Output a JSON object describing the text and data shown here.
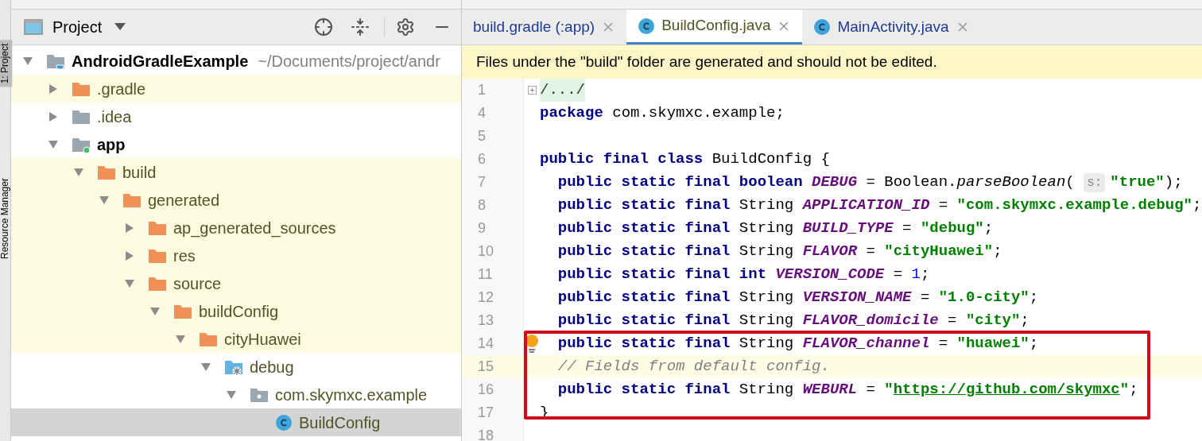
{
  "side_tabs": [
    {
      "label": "1: Project",
      "selected": true
    },
    {
      "label": "Resource Manager",
      "selected": false
    }
  ],
  "project_panel": {
    "title": "Project",
    "tree": [
      {
        "name": "AndroidGradleExample",
        "path": "~/Documents/project/andr",
        "bold": true,
        "kind": "project",
        "expanded": true,
        "excluded": false,
        "selected": false,
        "children": [
          {
            "name": ".gradle",
            "kind": "folder-orange",
            "expanded": false,
            "excluded": true,
            "selected": false
          },
          {
            "name": ".idea",
            "kind": "folder-gray",
            "expanded": false,
            "excluded": false,
            "selected": false
          },
          {
            "name": "app",
            "bold": true,
            "kind": "module",
            "expanded": true,
            "excluded": false,
            "selected": false,
            "children": [
              {
                "name": "build",
                "kind": "folder-orange",
                "expanded": true,
                "excluded": true,
                "selected": false,
                "children": [
                  {
                    "name": "generated",
                    "kind": "folder-orange",
                    "expanded": true,
                    "excluded": true,
                    "selected": false,
                    "children": [
                      {
                        "name": "ap_generated_sources",
                        "kind": "folder-orange",
                        "expanded": false,
                        "excluded": true,
                        "selected": false
                      },
                      {
                        "name": "res",
                        "kind": "folder-orange",
                        "expanded": false,
                        "excluded": true,
                        "selected": false
                      },
                      {
                        "name": "source",
                        "kind": "folder-orange",
                        "expanded": true,
                        "excluded": true,
                        "selected": false,
                        "children": [
                          {
                            "name": "buildConfig",
                            "kind": "folder-orange",
                            "expanded": true,
                            "excluded": true,
                            "selected": false,
                            "children": [
                              {
                                "name": "cityHuawei",
                                "kind": "folder-orange",
                                "expanded": true,
                                "excluded": true,
                                "selected": false,
                                "children": [
                                  {
                                    "name": "debug",
                                    "kind": "source-folder",
                                    "expanded": true,
                                    "excluded": false,
                                    "selected": false,
                                    "children": [
                                      {
                                        "name": "com.skymxc.example",
                                        "kind": "package",
                                        "expanded": true,
                                        "excluded": false,
                                        "selected": false,
                                        "children": [
                                          {
                                            "name": "BuildConfig",
                                            "kind": "class",
                                            "selected": true
                                          }
                                        ]
                                      }
                                    ]
                                  }
                                ]
                              }
                            ]
                          }
                        ]
                      }
                    ]
                  }
                ]
              }
            ]
          }
        ]
      }
    ]
  },
  "editor": {
    "tabs": [
      {
        "label": "build.gradle (:app)",
        "kind": "gradle",
        "selected": false
      },
      {
        "label": "BuildConfig.java",
        "kind": "class",
        "selected": true
      },
      {
        "label": "MainActivity.java",
        "kind": "class",
        "selected": false
      }
    ],
    "banner": "Files under the \"build\" folder are generated and should not be edited.",
    "lines": [
      {
        "number": "1",
        "current": false,
        "tokens": [
          {
            "kind": "folded",
            "text": "/.../"
          }
        ]
      },
      {
        "number": "4",
        "current": false,
        "tokens": [
          {
            "kind": "kw",
            "text": "package"
          },
          {
            "kind": "plain",
            "text": " com.skymxc.example;"
          }
        ]
      },
      {
        "number": "5",
        "current": false
      },
      {
        "number": "6",
        "current": false,
        "tokens": [
          {
            "kind": "kw",
            "text": "public final class"
          },
          {
            "kind": "plain",
            "text": " BuildConfig {"
          }
        ]
      },
      {
        "number": "7",
        "current": false,
        "tokens": [
          {
            "kind": "kw",
            "text": "  public static final boolean "
          },
          {
            "kind": "field",
            "text": "DEBUG"
          },
          {
            "kind": "plain",
            "text": " = Boolean."
          },
          {
            "kind": "method",
            "text": "parseBoolean"
          },
          {
            "kind": "plain",
            "text": "( "
          },
          {
            "kind": "hint",
            "text": "s:"
          },
          {
            "kind": "str",
            "text": "\"true\""
          },
          {
            "kind": "plain",
            "text": ");"
          }
        ]
      },
      {
        "number": "8",
        "current": false,
        "tokens": [
          {
            "kind": "kw",
            "text": "  public static final"
          },
          {
            "kind": "plain",
            "text": " String "
          },
          {
            "kind": "field",
            "text": "APPLICATION_ID"
          },
          {
            "kind": "plain",
            "text": " = "
          },
          {
            "kind": "str",
            "text": "\"com.skymxc.example.debug\""
          },
          {
            "kind": "plain",
            "text": ";"
          }
        ]
      },
      {
        "number": "9",
        "current": false,
        "tokens": [
          {
            "kind": "kw",
            "text": "  public static final"
          },
          {
            "kind": "plain",
            "text": " String "
          },
          {
            "kind": "field",
            "text": "BUILD_TYPE"
          },
          {
            "kind": "plain",
            "text": " = "
          },
          {
            "kind": "str",
            "text": "\"debug\""
          },
          {
            "kind": "plain",
            "text": ";"
          }
        ]
      },
      {
        "number": "10",
        "current": false,
        "tokens": [
          {
            "kind": "kw",
            "text": "  public static final"
          },
          {
            "kind": "plain",
            "text": " String "
          },
          {
            "kind": "field",
            "text": "FLAVOR"
          },
          {
            "kind": "plain",
            "text": " = "
          },
          {
            "kind": "str",
            "text": "\"cityHuawei\""
          },
          {
            "kind": "plain",
            "text": ";"
          }
        ]
      },
      {
        "number": "11",
        "current": false,
        "tokens": [
          {
            "kind": "kw",
            "text": "  public static final int "
          },
          {
            "kind": "field",
            "text": "VERSION_CODE"
          },
          {
            "kind": "plain",
            "text": " = "
          },
          {
            "kind": "num",
            "text": "1"
          },
          {
            "kind": "plain",
            "text": ";"
          }
        ]
      },
      {
        "number": "12",
        "current": false,
        "tokens": [
          {
            "kind": "kw",
            "text": "  public static final"
          },
          {
            "kind": "plain",
            "text": " String "
          },
          {
            "kind": "field",
            "text": "VERSION_NAME"
          },
          {
            "kind": "plain",
            "text": " = "
          },
          {
            "kind": "str",
            "text": "\"1.0-city\""
          },
          {
            "kind": "plain",
            "text": ";"
          }
        ]
      },
      {
        "number": "13",
        "current": false,
        "tokens": [
          {
            "kind": "kw",
            "text": "  public static final"
          },
          {
            "kind": "plain",
            "text": " String "
          },
          {
            "kind": "field",
            "text": "FLAVOR_domicile"
          },
          {
            "kind": "plain",
            "text": " = "
          },
          {
            "kind": "str",
            "text": "\"city\""
          },
          {
            "kind": "plain",
            "text": ";"
          }
        ]
      },
      {
        "number": "14",
        "current": false,
        "bulb": true,
        "tokens": [
          {
            "kind": "kw",
            "text": "  public static final"
          },
          {
            "kind": "plain",
            "text": " String "
          },
          {
            "kind": "field",
            "text": "FLAVOR_channel"
          },
          {
            "kind": "plain",
            "text": " = "
          },
          {
            "kind": "str",
            "text": "\"huawei\""
          },
          {
            "kind": "plain",
            "text": ";"
          }
        ]
      },
      {
        "number": "15",
        "current": true,
        "tokens": [
          {
            "kind": "comment",
            "text": "  // Fields from default config."
          }
        ]
      },
      {
        "number": "16",
        "current": false,
        "tokens": [
          {
            "kind": "kw",
            "text": "  public static final"
          },
          {
            "kind": "plain",
            "text": " String "
          },
          {
            "kind": "field",
            "text": "WEBURL"
          },
          {
            "kind": "plain",
            "text": " = "
          },
          {
            "kind": "str",
            "text": "\""
          },
          {
            "kind": "url",
            "text": "https://github.com/skymxc"
          },
          {
            "kind": "str",
            "text": "\""
          },
          {
            "kind": "plain",
            "text": ";"
          }
        ]
      },
      {
        "number": "17",
        "current": false,
        "tokens": [
          {
            "kind": "plain",
            "text": "}"
          }
        ]
      },
      {
        "number": "18",
        "current": false
      }
    ]
  }
}
